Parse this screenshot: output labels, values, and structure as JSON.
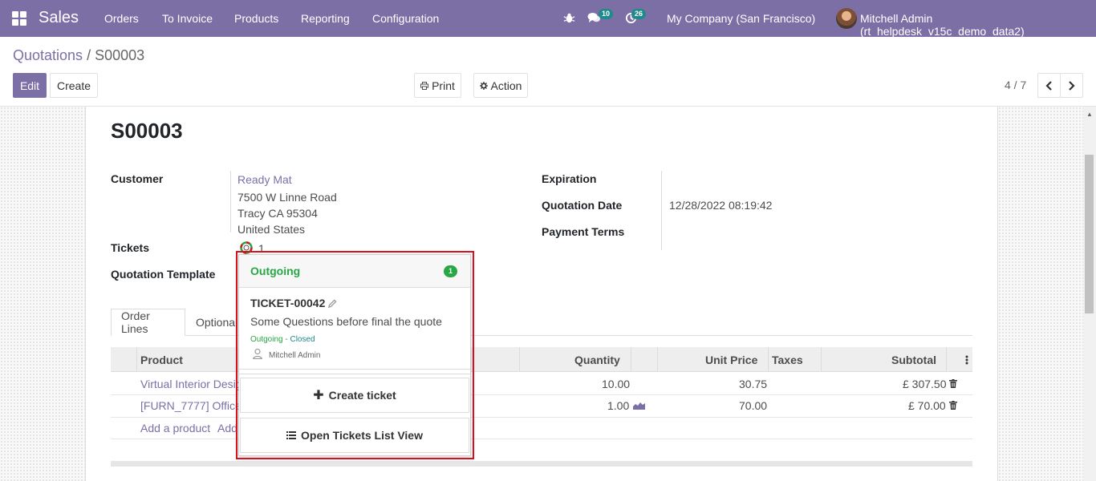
{
  "navbar": {
    "app_name": "Sales",
    "menu": [
      "Orders",
      "To Invoice",
      "Products",
      "Reporting",
      "Configuration"
    ],
    "chat_badge": "10",
    "activity_badge": "26",
    "company": "My Company (San Francisco)",
    "user": "Mitchell Admin (rt_helpdesk_v15c_demo_data2)",
    "color": "#7c6fa6"
  },
  "breadcrumb": {
    "parent": "Quotations",
    "separator": " / ",
    "current": "S00003"
  },
  "buttons": {
    "edit": "Edit",
    "create": "Create",
    "print": "Print",
    "action": "Action"
  },
  "pager": {
    "value": "4 / 7"
  },
  "record": {
    "name": "S00003",
    "customer_label": "Customer",
    "customer_name": "Ready Mat",
    "address": [
      "7500 W Linne Road",
      "Tracy CA 95304",
      "United States"
    ],
    "tickets_label": "Tickets",
    "tickets_count": "1",
    "template_label": "Quotation Template",
    "expiration_label": "Expiration",
    "quotation_date_label": "Quotation Date",
    "quotation_date": "12/28/2022 08:19:42",
    "payment_terms_label": "Payment Terms"
  },
  "tabs": [
    "Order Lines",
    "Optional"
  ],
  "table": {
    "headers": {
      "product": "Product",
      "quantity": "Quantity",
      "unit_price": "Unit Price",
      "taxes": "Taxes",
      "subtotal": "Subtotal"
    },
    "rows": [
      {
        "product": "Virtual Interior Design",
        "quantity": "10.00",
        "unit_price": "30.75",
        "subtotal": "£ 307.50"
      },
      {
        "product": "[FURN_7777] Office",
        "quantity": "1.00",
        "unit_price": "70.00",
        "subtotal": "£ 70.00"
      }
    ],
    "add_product": "Add a product",
    "add_section": "Add"
  },
  "popover": {
    "title": "Outgoing",
    "count": "1",
    "ticket": {
      "id": "TICKET-00042",
      "description": "Some Questions before final the quote",
      "stage": "Outgoing",
      "stage_sep": " - ",
      "state": "Closed",
      "user": "Mitchell Admin"
    },
    "create_ticket": "Create ticket",
    "open_list": "Open Tickets List View"
  }
}
